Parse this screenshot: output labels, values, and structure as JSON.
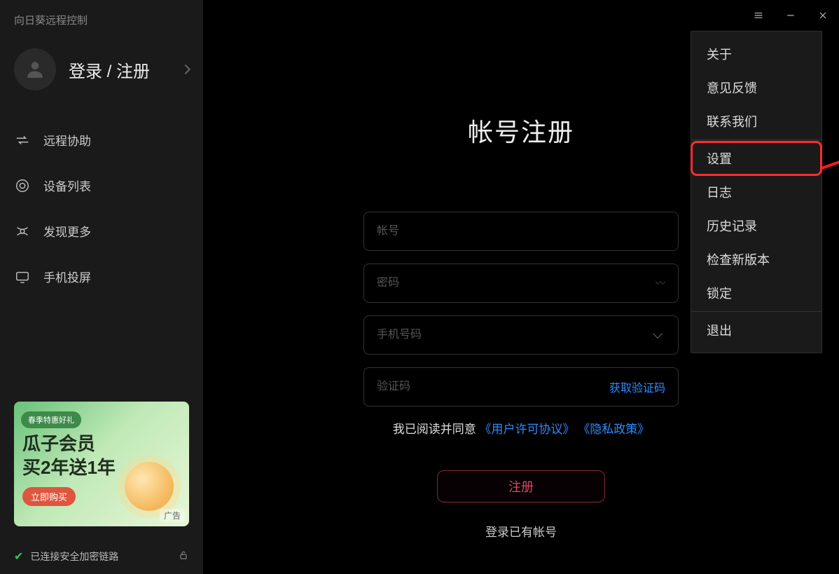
{
  "app_title": "向日葵远程控制",
  "profile_label": "登录 / 注册",
  "nav": {
    "remote_assist": "远程协助",
    "device_list": "设备列表",
    "discover_more": "发现更多",
    "phone_cast": "手机投屏"
  },
  "promo": {
    "pill": "春季特惠好礼",
    "line1": "瓜子会员",
    "line2": "买2年送1年",
    "buy": "立即购买",
    "ad_tag": "广告"
  },
  "status": {
    "text": "已连接安全加密链路"
  },
  "form": {
    "title": "帐号注册",
    "account_ph": "帐号",
    "password_ph": "密码",
    "phone_ph": "手机号码",
    "code_ph": "验证码",
    "get_code": "获取验证码",
    "agree_prefix": "我已阅读并同意",
    "license": "《用户许可协议》",
    "privacy": "《隐私政策》",
    "register": "注册",
    "login_existing": "登录已有帐号"
  },
  "menu": {
    "about": "关于",
    "feedback": "意见反馈",
    "contact": "联系我们",
    "settings": "设置",
    "logs": "日志",
    "history": "历史记录",
    "check_update": "检查新版本",
    "lock": "锁定",
    "exit": "退出"
  }
}
